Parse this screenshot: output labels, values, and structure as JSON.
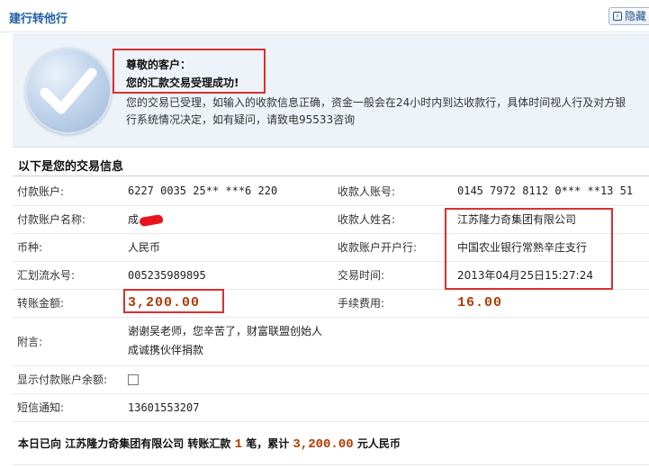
{
  "header": {
    "title": "建行转他行",
    "hide_label": "隐藏"
  },
  "success": {
    "greeting": "尊敬的客户：",
    "message": "您的汇款交易受理成功!",
    "notice": "您的交易已受理，如输入的收款信息正确，资金一般会在24小时内到达收款行，具体时间视人行及对方银行系统情况决定，如有疑问，请致电95533咨询"
  },
  "section_title": "以下是您的交易信息",
  "transaction": {
    "payer_account_label": "付款账户:",
    "payer_account": "6227 0035 25** ***6 220",
    "payee_account_label": "收款人账号:",
    "payee_account": "0145 7972 8112 0*** **13 51",
    "payer_name_label": "付款账户名称:",
    "payer_name": "成",
    "payee_name_label": "收款人姓名:",
    "payee_name": "江苏隆力奇集团有限公司",
    "currency_label": "币种:",
    "currency": "人民币",
    "payee_bank_label": "收款账户开户行:",
    "payee_bank": "中国农业银行常熟辛庄支行",
    "serial_label": "汇划流水号:",
    "serial": "005235989895",
    "time_label": "交易时间:",
    "time": "2013年04月25日15:27:24",
    "amount_label": "转账金额:",
    "amount": "3,200.00",
    "fee_label": "手续费用:",
    "fee": "16.00",
    "remark_label": "附言:",
    "remark": "谢谢吴老师，您辛苦了，财富联盟创始人成诚携伙伴捐款",
    "show_balance_label": "显示付款账户余额:",
    "show_balance_checked": false,
    "sms_label": "短信通知:",
    "sms": "13601553207"
  },
  "summary": {
    "prefix": "本日已向",
    "payee": "江苏隆力奇集团有限公司",
    "mid": "转账汇款",
    "count": "1",
    "unit": "笔，累计",
    "total": "3,200.00",
    "suffix": "元人民币"
  },
  "colors": {
    "title_blue": "#1f5fa8",
    "highlight_red": "#d93030",
    "amount_brown": "#b03a00",
    "panel_bg": "#edf3f8"
  }
}
